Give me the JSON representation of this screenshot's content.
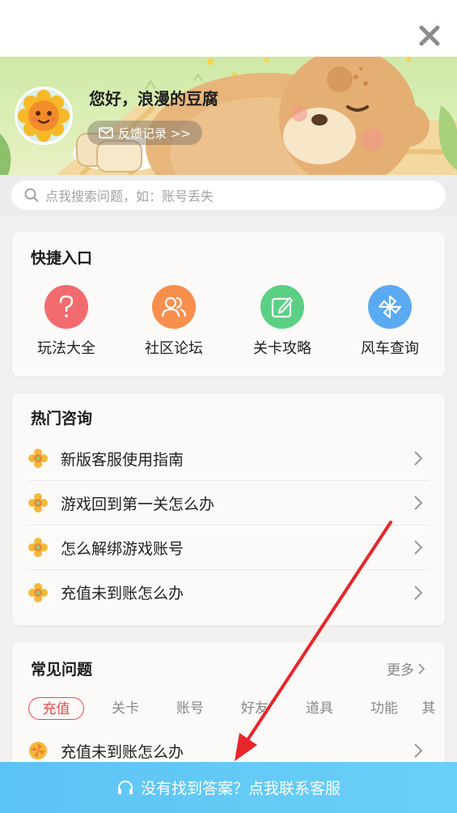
{
  "header": {
    "close_icon": "close-icon"
  },
  "profile": {
    "greeting": "您好，浪漫的豆腐",
    "feedback_label": "反馈记录 >>"
  },
  "search": {
    "placeholder": "点我搜索问题，如：账号丢失"
  },
  "quick_entry": {
    "title": "快捷入口",
    "items": [
      {
        "label": "玩法大全",
        "icon": "question-icon",
        "color": "#f26b6f"
      },
      {
        "label": "社区论坛",
        "icon": "community-icon",
        "color": "#f98f4c"
      },
      {
        "label": "关卡攻略",
        "icon": "edit-icon",
        "color": "#5bcf84"
      },
      {
        "label": "风车查询",
        "icon": "windmill-icon",
        "color": "#5aaaf2"
      }
    ]
  },
  "hot_consult": {
    "title": "热门咨询",
    "items": [
      {
        "label": "新版客服使用指南"
      },
      {
        "label": "游戏回到第一关怎么办"
      },
      {
        "label": "怎么解绑游戏账号"
      },
      {
        "label": "充值未到账怎么办"
      }
    ]
  },
  "faq": {
    "title": "常见问题",
    "more_label": "更多",
    "tabs": [
      "充值",
      "关卡",
      "账号",
      "好友",
      "道具",
      "功能",
      "其"
    ],
    "active_tab": "充值",
    "first_item": "充值未到账怎么办"
  },
  "contact": {
    "label": "没有找到答案？点我联系客服"
  },
  "colors": {
    "accent_red": "#e84b4b",
    "contact_blue": "#5cc3f5",
    "annotation_arrow": "#e8262a"
  }
}
